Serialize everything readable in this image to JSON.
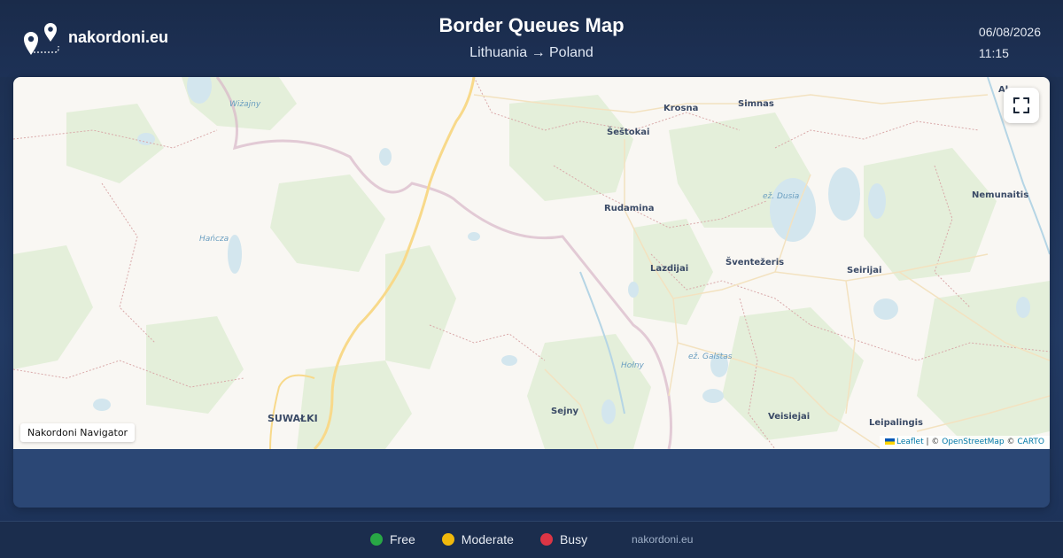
{
  "header": {
    "site_name": "nakordoni.eu",
    "title": "Border Queues Map",
    "route": "Lithuania → Poland",
    "date": "06/08/2026",
    "time": "11:15"
  },
  "map": {
    "places": [
      {
        "name": "Krosna",
        "kind": "town"
      },
      {
        "name": "Simnas",
        "kind": "town"
      },
      {
        "name": "Šeštokai",
        "kind": "town"
      },
      {
        "name": "Rudamina",
        "kind": "town"
      },
      {
        "name": "Lazdijai",
        "kind": "town"
      },
      {
        "name": "Šventežeris",
        "kind": "town"
      },
      {
        "name": "Seirijai",
        "kind": "town"
      },
      {
        "name": "Nemunaitis",
        "kind": "town"
      },
      {
        "name": "SUWAŁKI",
        "kind": "city"
      },
      {
        "name": "Sejny",
        "kind": "town"
      },
      {
        "name": "Veisiejai",
        "kind": "town"
      },
      {
        "name": "Leipalingis",
        "kind": "town"
      },
      {
        "name": "Al",
        "kind": "town"
      },
      {
        "name": "Wiżajny",
        "kind": "water"
      },
      {
        "name": "Hańcza",
        "kind": "water"
      },
      {
        "name": "ež. Dusia",
        "kind": "water"
      },
      {
        "name": "ež. Galstas",
        "kind": "water"
      },
      {
        "name": "Hołny",
        "kind": "water"
      }
    ],
    "fullscreen_icon": "fullscreen-icon",
    "control_label": "Nakordoni Navigator",
    "attribution": {
      "leaflet": "Leaflet",
      "sep1": " | © ",
      "osm": "OpenStreetMap",
      "sep2": " © ",
      "carto": "CARTO"
    }
  },
  "legend": [
    {
      "label": "Free",
      "color": "#28a745"
    },
    {
      "label": "Moderate",
      "color": "#f1b90c"
    },
    {
      "label": "Busy",
      "color": "#dc3545"
    }
  ],
  "footer": {
    "site": "nakordoni.eu"
  }
}
